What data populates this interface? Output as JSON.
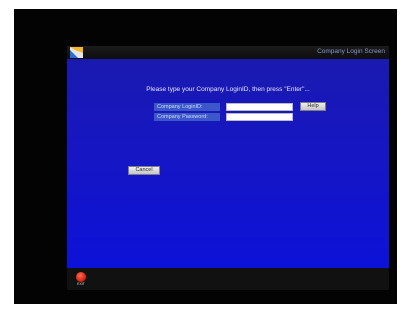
{
  "window": {
    "title": "Company Login Screen"
  },
  "form": {
    "prompt": "Please type your Company LoginID, then press \"Enter\"...",
    "login_label": "Company LoginID:",
    "login_value": "",
    "password_label": "Company Password:",
    "password_value": ""
  },
  "buttons": {
    "help": "Help",
    "cancel": "Cancel",
    "exit": "EXIT"
  },
  "icons": {
    "logo": "app-logo-icon",
    "exit": "exit-icon"
  },
  "colors": {
    "content_background": "#1616c4",
    "label_background": "#3b57c9",
    "exit_red": "#d21a0c"
  }
}
